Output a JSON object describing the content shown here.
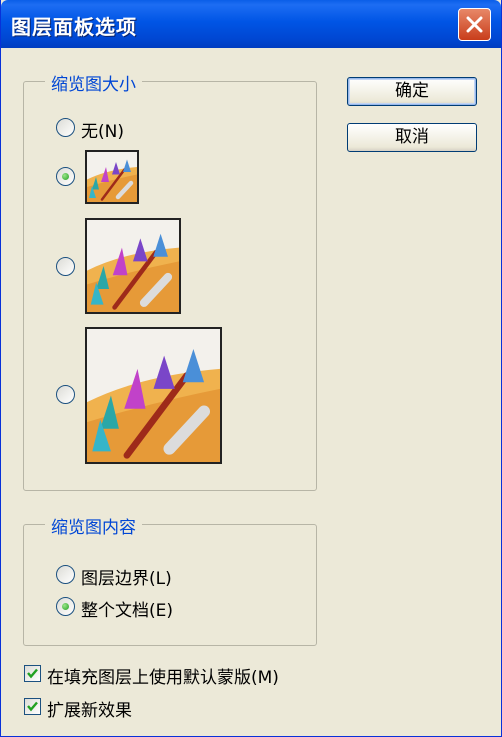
{
  "window": {
    "title": "图层面板选项",
    "close_icon": "close-icon"
  },
  "buttons": {
    "ok": "确定",
    "cancel": "取消"
  },
  "thumbnail_size": {
    "legend": "缩览图大小",
    "options": [
      {
        "label": "无(N)",
        "selected": false
      },
      {
        "label": "",
        "size": "small",
        "selected": true
      },
      {
        "label": "",
        "size": "medium",
        "selected": false
      },
      {
        "label": "",
        "size": "large",
        "selected": false
      }
    ]
  },
  "thumbnail_contents": {
    "legend": "缩览图内容",
    "options": [
      {
        "label": "图层边界(L)",
        "selected": false
      },
      {
        "label": "整个文档(E)",
        "selected": true
      }
    ]
  },
  "checkboxes": [
    {
      "label": "在填充图层上使用默认蒙版(M)",
      "checked": true
    },
    {
      "label": "扩展新效果",
      "checked": true
    }
  ],
  "colors": {
    "title_bar": "#0055e5",
    "close_button": "#c93d1b",
    "legend_text": "#0046d5",
    "radio_selected": "#21a121",
    "dialog_bg": "#ece9d8"
  }
}
